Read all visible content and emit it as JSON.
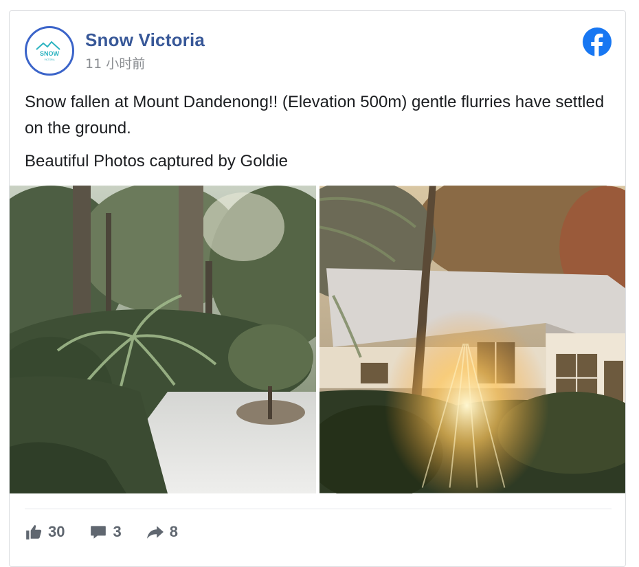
{
  "post": {
    "page_name": "Snow Victoria",
    "time": "11 小时前",
    "avatar_logo_text": "SNOW",
    "avatar_logo_subtext": "VICTORIA",
    "text_line_1": "Snow fallen at Mount Dandenong!! (Elevation 500m) gentle flurries have settled on the ground.",
    "text_line_2": "Beautiful Photos captured by Goldie",
    "photos": [
      {
        "icon": "photo-snowy-garden-ferns"
      },
      {
        "icon": "photo-house-with-sun-flare"
      }
    ]
  },
  "stats": {
    "likes": "30",
    "comments": "3",
    "shares": "8"
  },
  "colors": {
    "brand": "#1877f2",
    "page_name": "#385898",
    "avatar_ring": "#3b64c9",
    "logo_teal": "#2bb3c0",
    "stat_text": "#606770"
  },
  "icons": {
    "facebook": "facebook-logo-icon",
    "like": "thumbs-up-icon",
    "comment": "comment-bubble-icon",
    "share": "share-arrow-icon"
  }
}
